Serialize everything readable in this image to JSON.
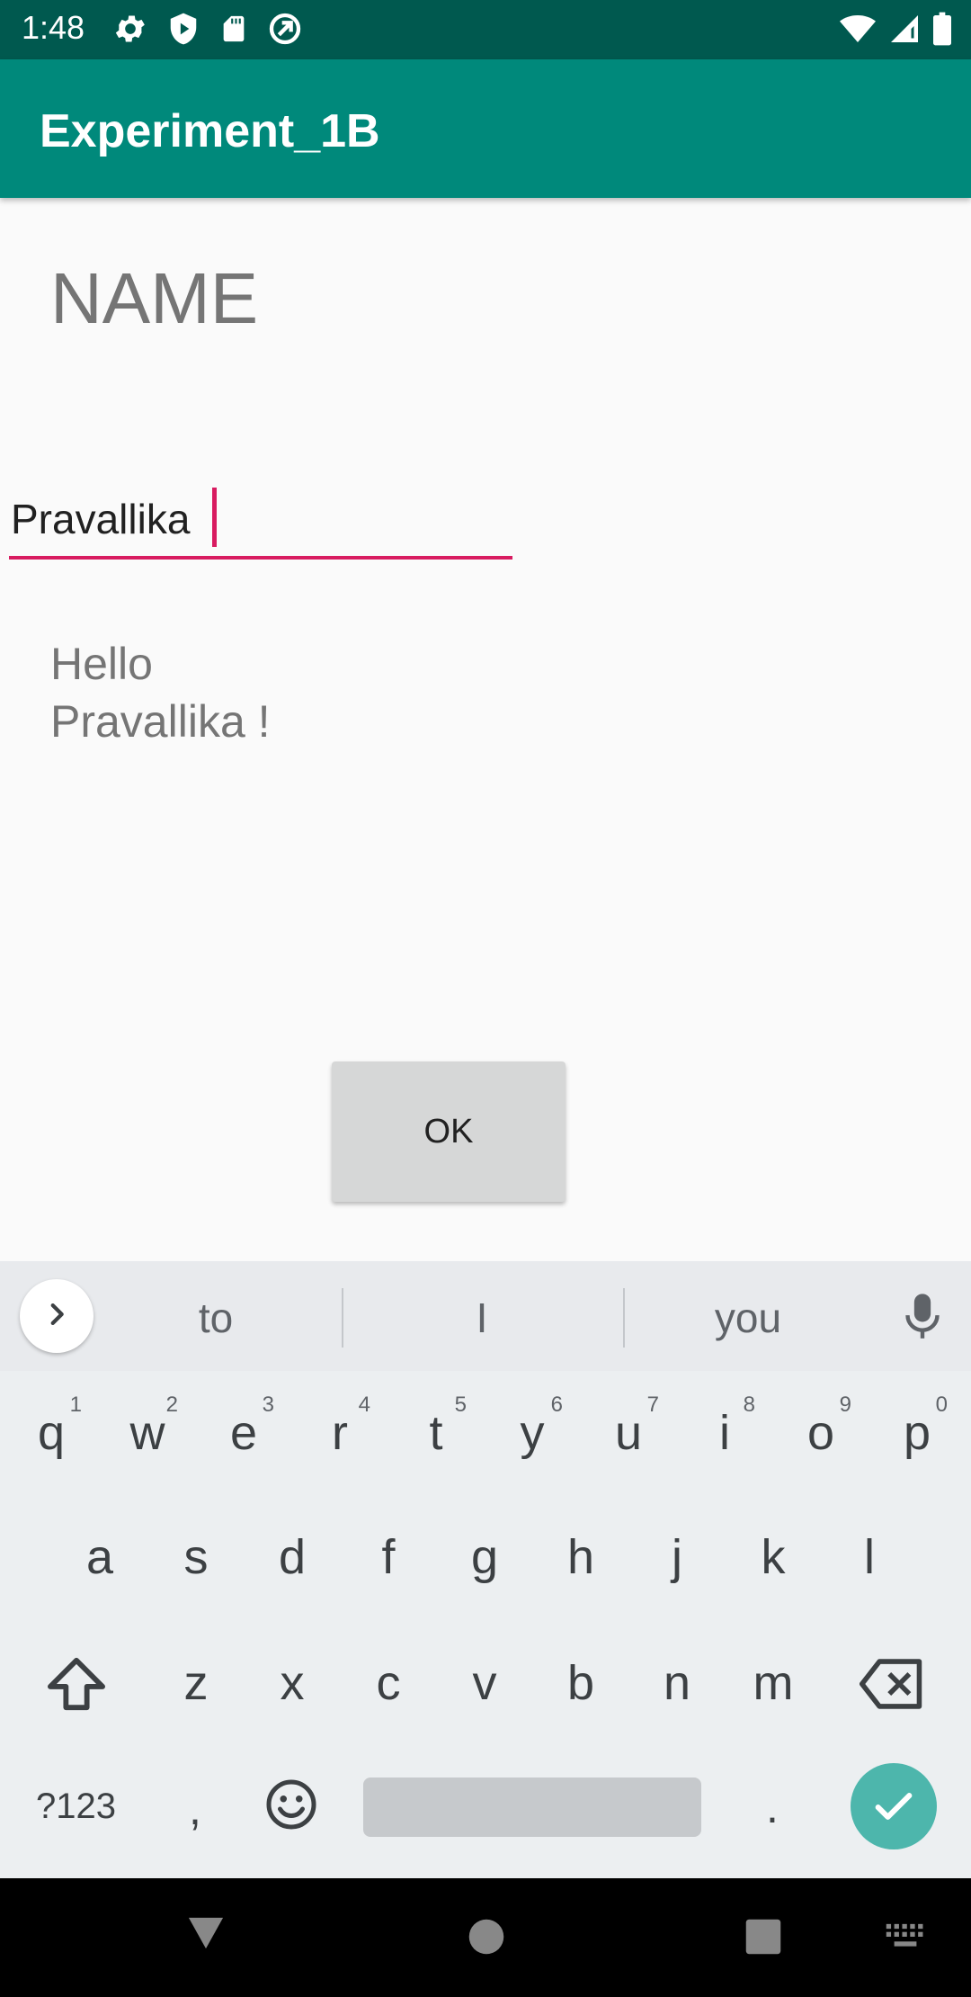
{
  "status_bar": {
    "time": "1:48"
  },
  "app_bar": {
    "title": "Experiment_1B"
  },
  "form": {
    "name_label": "NAME",
    "name_input_value": "Pravallika",
    "greeting_line1": "Hello",
    "greeting_line2": "Pravallika !",
    "ok_button_label": "OK"
  },
  "keyboard": {
    "suggestions": [
      "to",
      "I",
      "you"
    ],
    "row1": [
      {
        "key": "q",
        "hint": "1"
      },
      {
        "key": "w",
        "hint": "2"
      },
      {
        "key": "e",
        "hint": "3"
      },
      {
        "key": "r",
        "hint": "4"
      },
      {
        "key": "t",
        "hint": "5"
      },
      {
        "key": "y",
        "hint": "6"
      },
      {
        "key": "u",
        "hint": "7"
      },
      {
        "key": "i",
        "hint": "8"
      },
      {
        "key": "o",
        "hint": "9"
      },
      {
        "key": "p",
        "hint": "0"
      }
    ],
    "row2": [
      "a",
      "s",
      "d",
      "f",
      "g",
      "h",
      "j",
      "k",
      "l"
    ],
    "row3": [
      "z",
      "x",
      "c",
      "v",
      "b",
      "n",
      "m"
    ],
    "symbols_label": "?123",
    "comma_label": ",",
    "period_label": "."
  },
  "colors": {
    "status_bar": "#00594f",
    "app_bar": "#00897b",
    "accent": "#d81b60",
    "enter_key": "#4db6ac"
  }
}
